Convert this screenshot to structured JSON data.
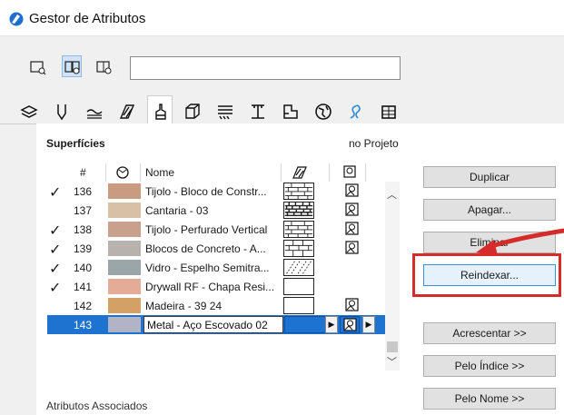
{
  "window": {
    "title": "Gestor de Atributos"
  },
  "toolbar": {
    "view_buttons": [
      "view-list-icon",
      "view-dual-list-icon",
      "view-single-icon"
    ],
    "search": {
      "value": "",
      "placeholder": ""
    }
  },
  "tabs": [
    {
      "icon": "layers-icon",
      "active": false
    },
    {
      "icon": "pen-icon",
      "active": false
    },
    {
      "icon": "line-type-icon",
      "active": false
    },
    {
      "icon": "fill-icon",
      "active": false
    },
    {
      "icon": "surface-brush-icon",
      "active": true
    },
    {
      "icon": "composite-icon",
      "active": false
    },
    {
      "icon": "profile-icon",
      "active": false
    },
    {
      "icon": "beam-icon",
      "active": false
    },
    {
      "icon": "zone-icon",
      "active": false
    },
    {
      "icon": "globe-icon",
      "active": false
    },
    {
      "icon": "mep-icon",
      "active": false
    },
    {
      "icon": "building-material-icon",
      "active": false
    }
  ],
  "section": {
    "title": "Superfícies",
    "project_label": "no Projeto"
  },
  "table": {
    "headers": {
      "num": "#",
      "name": "Nome"
    },
    "rows": [
      {
        "checked": true,
        "num": "136",
        "color": "#c99b80",
        "name": "Tijolo - Bloco de Constr...",
        "pattern": "brick",
        "map": true
      },
      {
        "checked": false,
        "num": "137",
        "color": "#d7c0a6",
        "name": "Cantaria - 03",
        "pattern": "stone",
        "map": true
      },
      {
        "checked": true,
        "num": "138",
        "color": "#c9a08b",
        "name": "Tijolo - Perfurado Vertical",
        "pattern": "brick",
        "map": true
      },
      {
        "checked": true,
        "num": "139",
        "color": "#b7b2ad",
        "name": "Blocos de Concreto - A...",
        "pattern": "brick",
        "map": true
      },
      {
        "checked": true,
        "num": "140",
        "color": "#9aa6a8",
        "name": "Vidro - Espelho Semitra...",
        "pattern": "glass",
        "map": false
      },
      {
        "checked": true,
        "num": "141",
        "color": "#e4ab96",
        "name": "Drywall RF - Chapa Resi...",
        "pattern": "empty",
        "map": false
      },
      {
        "checked": false,
        "num": "142",
        "color": "#d3a065",
        "name": "Madeira - 39 24",
        "pattern": "empty",
        "map": true
      },
      {
        "checked": false,
        "num": "143",
        "color": "#b2b3c6",
        "name": "Metal - Aço Escovado 02",
        "pattern": "selected",
        "map": true,
        "selected": true
      }
    ]
  },
  "buttons": {
    "duplicate": "Duplicar",
    "delete": "Apagar...",
    "remove": "Eliminar",
    "reindex": "Reindexar...",
    "append": "Acrescentar >>",
    "by_index": "Pelo Índice >>",
    "by_name": "Pelo Nome >>"
  },
  "footer": {
    "associated": "Atributos Associados"
  },
  "colors": {
    "selection": "#1f73d0",
    "annotation": "#d62b2b"
  }
}
